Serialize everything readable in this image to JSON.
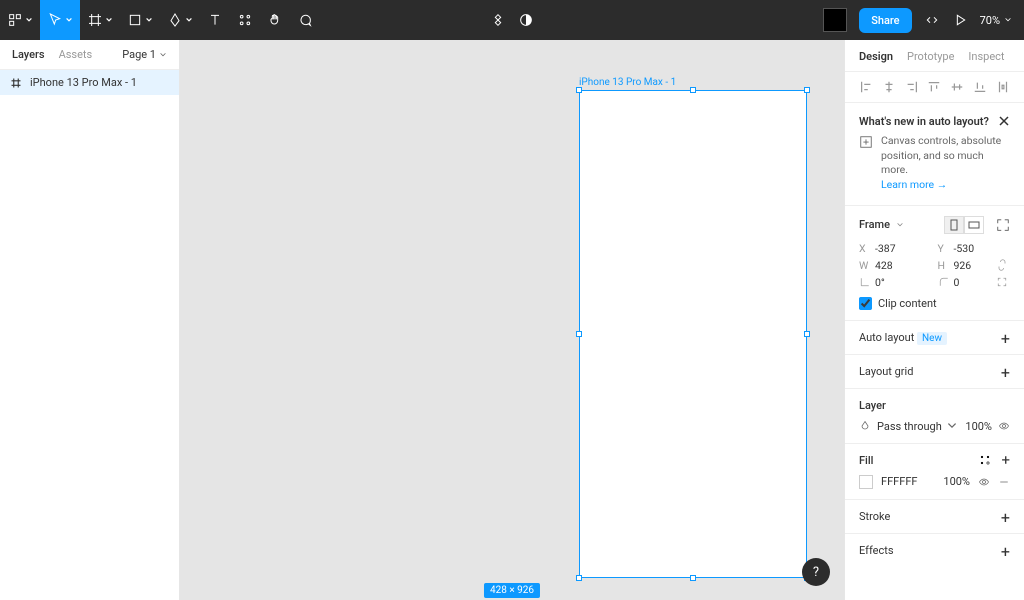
{
  "toolbar": {
    "share_label": "Share",
    "zoom": "70%"
  },
  "left": {
    "tabs": {
      "layers": "Layers",
      "assets": "Assets"
    },
    "page": "Page 1",
    "layer_name": "iPhone 13 Pro Max - 1"
  },
  "canvas": {
    "frame_label": "iPhone 13 Pro Max - 1",
    "dimensions_badge": "428 × 926"
  },
  "right": {
    "tabs": {
      "design": "Design",
      "prototype": "Prototype",
      "inspect": "Inspect"
    },
    "whatsnew": {
      "title": "What's new in auto layout?",
      "body": "Canvas controls, absolute position, and so much more.",
      "link": "Learn more →"
    },
    "frame": {
      "title": "Frame",
      "x_label": "X",
      "x": "-387",
      "y_label": "Y",
      "y": "-530",
      "w_label": "W",
      "w": "428",
      "h_label": "H",
      "h": "926",
      "rot": "0°",
      "corner": "0",
      "clip": "Clip content"
    },
    "autolayout": {
      "title": "Auto layout",
      "badge": "New"
    },
    "layoutgrid": "Layout grid",
    "layer": {
      "title": "Layer",
      "blend": "Pass through",
      "opacity": "100%"
    },
    "fill": {
      "title": "Fill",
      "hex": "FFFFFF",
      "opacity": "100%"
    },
    "stroke": "Stroke",
    "effects": "Effects"
  },
  "help": "?"
}
